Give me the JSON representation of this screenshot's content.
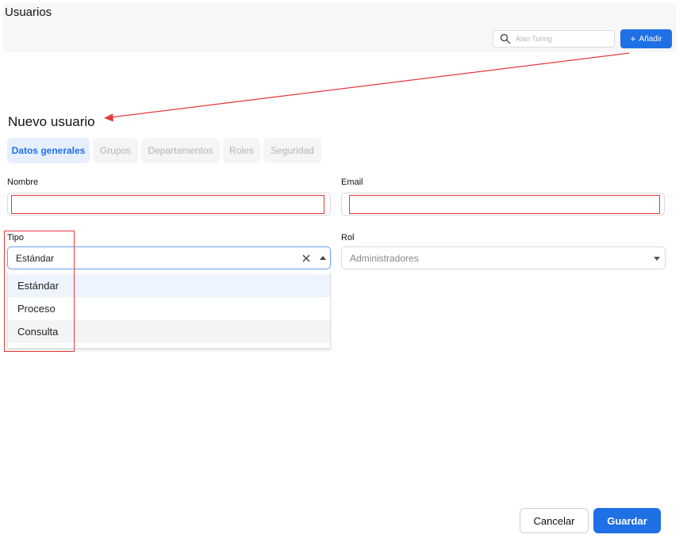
{
  "header": {
    "title": "Usuarios",
    "search_placeholder": "Alan Turing",
    "add_label": "Añadir",
    "add_icon": "plus-icon",
    "search_icon": "search-icon"
  },
  "form": {
    "title": "Nuevo usuario",
    "tabs": [
      {
        "label": "Datos generales",
        "active": true
      },
      {
        "label": "Grupos",
        "active": false
      },
      {
        "label": "Departamentos",
        "active": false
      },
      {
        "label": "Roles",
        "active": false
      },
      {
        "label": "Seguridad",
        "active": false
      }
    ],
    "nombre_label": "Nombre",
    "nombre_value": "",
    "email_label": "Email",
    "email_value": "",
    "tipo_label": "Tipo",
    "tipo_value": "Estándar",
    "tipo_options": [
      "Estándar",
      "Proceso",
      "Consulta"
    ],
    "rol_label": "Rol",
    "rol_value": "Administradores"
  },
  "footer": {
    "cancel_label": "Cancelar",
    "save_label": "Guardar"
  },
  "colors": {
    "accent": "#1f6fe5",
    "annotation": "#e23a3a"
  }
}
